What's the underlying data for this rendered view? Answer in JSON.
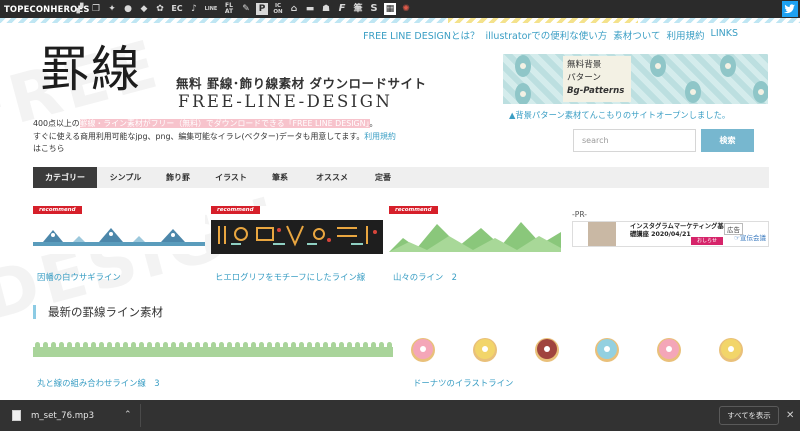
{
  "topbar": {
    "brand": "TOPECONHEROES",
    "icons": [
      "dog-icon",
      "copy-icon",
      "person-icon",
      "speech-bubble-icon",
      "leaf-icon",
      "flower-icon",
      "ec-icon",
      "music-note-icon",
      "line-icon",
      "flat-icon",
      "pencil-icon",
      "p-icon",
      "icon-on-icon",
      "house-icon",
      "bed-icon",
      "cat-icon",
      "f-icon",
      "brush-icon",
      "s-icon",
      "grid-icon",
      "sparkle-icon"
    ],
    "icon_text": {
      "ec": "EC",
      "line": "LINE",
      "flat": "FL AT",
      "p": "P",
      "iconon": "IC ON",
      "f": "F",
      "s": "S"
    },
    "twitter_icon": "twitter-icon"
  },
  "topnav": [
    "FREE LINE DESIGNとは？",
    "illustratorでの便利な使い方",
    "素材ついて",
    "利用規約",
    "LINKS"
  ],
  "logo": {
    "kanji": "罫線",
    "subtitle": "無料 罫線･飾り線素材 ダウンロードサイト",
    "english": "FREE-LINE-DESIGN"
  },
  "intro": {
    "line1_prefix": "400点以上の",
    "line1_highlight": "罫線・ライン素材がフリー（無料）でダウンロードできる「FREE LINE DESIGN」",
    "line1_suffix": "。",
    "line2": "すぐに使える商用利用可能なjpg、png、編集可能なイラレ(ベクター)データも用意してます。",
    "terms_link": "利用規約",
    "line3": "はこちら"
  },
  "banner": {
    "line1": "無料背景",
    "line2": "パターン",
    "line3": "Bg-Patterns",
    "caption": "▲背景パターン素材てんこもりのサイトオープンしました。"
  },
  "search": {
    "placeholder": "search",
    "button": "検索"
  },
  "categories": [
    "カテゴリー",
    "シンプル",
    "飾り罫",
    "イラスト",
    "筆系",
    "オススメ",
    "定番"
  ],
  "recommend_label": "recommend",
  "featured": [
    {
      "title": "因幡の白ウサギライン"
    },
    {
      "title": "ヒエログリフをモチーフにしたライン線"
    },
    {
      "title": "山々のライン　2"
    }
  ],
  "ad": {
    "pr_label": "-PR-",
    "title": "インスタグラムマーケティング基礎講座 2020/04/21",
    "button": "おしらせ",
    "tag": "広告",
    "sub": "☞宣伝会議"
  },
  "latest": {
    "heading": "最新の罫線ライン素材",
    "items": [
      {
        "title": "丸と線の組み合わせライン線　3"
      },
      {
        "title": "ドーナツのイラストライン"
      }
    ]
  },
  "download_bar": {
    "file": "m_set_76.mp3",
    "show_all": "すべてを表示"
  },
  "colors": {
    "accent": "#3a9ec4",
    "recommend": "#d61f2a",
    "nav_active": "#3b3b3b",
    "search_button": "#77b7cf"
  }
}
